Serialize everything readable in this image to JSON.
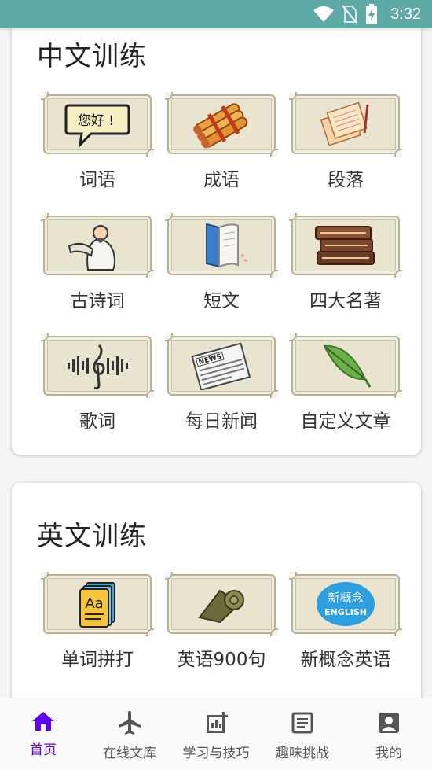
{
  "status_bar": {
    "time": "3:32"
  },
  "chinese_section": {
    "title": "中文训练",
    "items": [
      {
        "label": "词语",
        "icon": "speech-bubble-icon"
      },
      {
        "label": "成语",
        "icon": "scroll-bundle-icon"
      },
      {
        "label": "段落",
        "icon": "paper-pen-icon"
      },
      {
        "label": "古诗词",
        "icon": "scholar-icon"
      },
      {
        "label": "短文",
        "icon": "open-book-icon"
      },
      {
        "label": "四大名著",
        "icon": "book-stack-icon"
      },
      {
        "label": "歌词",
        "icon": "music-note-icon"
      },
      {
        "label": "每日新闻",
        "icon": "newspaper-icon"
      },
      {
        "label": "自定义文章",
        "icon": "leaf-icon"
      }
    ]
  },
  "english_section": {
    "title": "英文训练",
    "items": [
      {
        "label": "单词拼打",
        "icon": "dictionary-icon"
      },
      {
        "label": "英语900句",
        "icon": "rolled-scroll-icon"
      },
      {
        "label": "新概念英语",
        "icon": "new-concept-badge-icon",
        "badge_text_top": "新概念",
        "badge_text_bottom": "ENGLISH"
      }
    ]
  },
  "bottom_nav": {
    "items": [
      {
        "label": "首页",
        "active": true
      },
      {
        "label": "在线文库",
        "active": false
      },
      {
        "label": "学习与技巧",
        "active": false
      },
      {
        "label": "趣味挑战",
        "active": false
      },
      {
        "label": "我的",
        "active": false
      }
    ]
  },
  "colors": {
    "status_bar": "#5fa9a6",
    "accent": "#6200ee",
    "tile_background": "#e8e4cf",
    "tile_border": "#b7b094"
  }
}
